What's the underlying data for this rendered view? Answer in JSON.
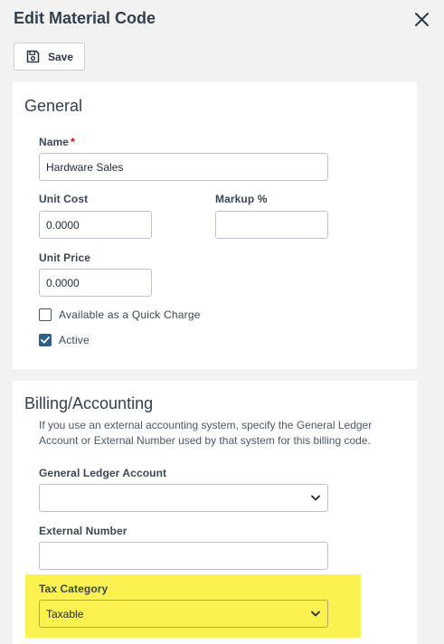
{
  "header": {
    "title": "Edit Material Code",
    "close_icon": "close-icon"
  },
  "toolbar": {
    "save_label": "Save",
    "save_icon": "floppy-disk-icon"
  },
  "general": {
    "title": "General",
    "name_label": "Name",
    "name_required_mark": "*",
    "name_value": "Hardware Sales",
    "unit_cost_label": "Unit Cost",
    "unit_cost_value": "0.0000",
    "markup_label": "Markup %",
    "markup_value": "",
    "unit_price_label": "Unit Price",
    "unit_price_value": "0.0000",
    "quick_charge_label": "Available as a Quick Charge",
    "quick_charge_checked": false,
    "active_label": "Active",
    "active_checked": true
  },
  "billing": {
    "title": "Billing/Accounting",
    "help_text": "If you use an external accounting system, specify the General Ledger Account or External Number used by that system for this billing code.",
    "gl_account_label": "General Ledger Account",
    "gl_account_value": "",
    "external_number_label": "External Number",
    "external_number_value": "",
    "tax_category_label": "Tax Category",
    "tax_category_value": "Taxable",
    "highlight_color": "#fbf24f"
  },
  "colors": {
    "accent": "#2f5e8a",
    "required": "#d0021b",
    "background": "#f2f2f2"
  }
}
